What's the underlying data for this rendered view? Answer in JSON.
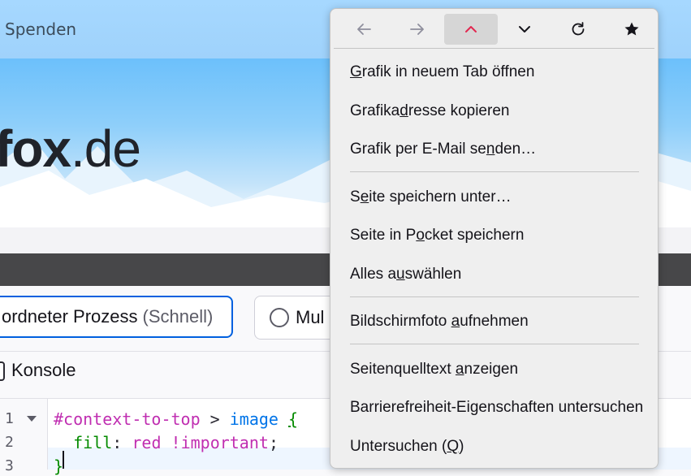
{
  "background": {
    "topbar_link": "Spenden",
    "logo_bold": "fox",
    "logo_rest": ".de",
    "process_option": {
      "label": "ordneter Prozess",
      "suffix": "(Schnell)"
    },
    "multi_option": {
      "label": "Mul"
    },
    "console_label": "Konsole",
    "editor": {
      "line_numbers": [
        "1",
        "2",
        "3"
      ],
      "line1": {
        "selector": "#context-to-top",
        "combinator": " > ",
        "tag": "image",
        "brace": "{"
      },
      "line2": {
        "indent": "  ",
        "property": "fill",
        "colon": ": ",
        "value": "red !important",
        "semi": ";"
      },
      "line3": {
        "brace": "}"
      }
    }
  },
  "menu": {
    "nav": [
      {
        "name": "back",
        "icon": "arrow-left-icon"
      },
      {
        "name": "forward",
        "icon": "arrow-right-icon"
      },
      {
        "name": "scroll-to-top",
        "icon": "chevron-up-icon",
        "color": "#e22850"
      },
      {
        "name": "scroll-down",
        "icon": "chevron-down-icon"
      },
      {
        "name": "reload",
        "icon": "reload-icon"
      },
      {
        "name": "bookmark",
        "icon": "star-icon"
      }
    ],
    "items": [
      {
        "pre": "",
        "key": "G",
        "post": "rafik in neuem Tab öffnen"
      },
      {
        "pre": "Grafika",
        "key": "d",
        "post": "resse kopieren"
      },
      {
        "pre": "Grafik per E-Mail se",
        "key": "n",
        "post": "den…"
      },
      {
        "pre": "S",
        "key": "e",
        "post": "ite speichern unter…"
      },
      {
        "pre": "Seite in P",
        "key": "o",
        "post": "cket speichern"
      },
      {
        "pre": "Alles a",
        "key": "u",
        "post": "swählen"
      },
      {
        "pre": "Bildschirmfoto ",
        "key": "a",
        "post": "ufnehmen"
      },
      {
        "pre": "Seitenquelltext ",
        "key": "a",
        "post": "nzeigen"
      },
      {
        "pre": "Barrierefreiheit-Eigenschaften untersuchen",
        "key": "",
        "post": ""
      },
      {
        "pre": "Untersuchen (",
        "key": "Q",
        "post": ")"
      }
    ]
  }
}
